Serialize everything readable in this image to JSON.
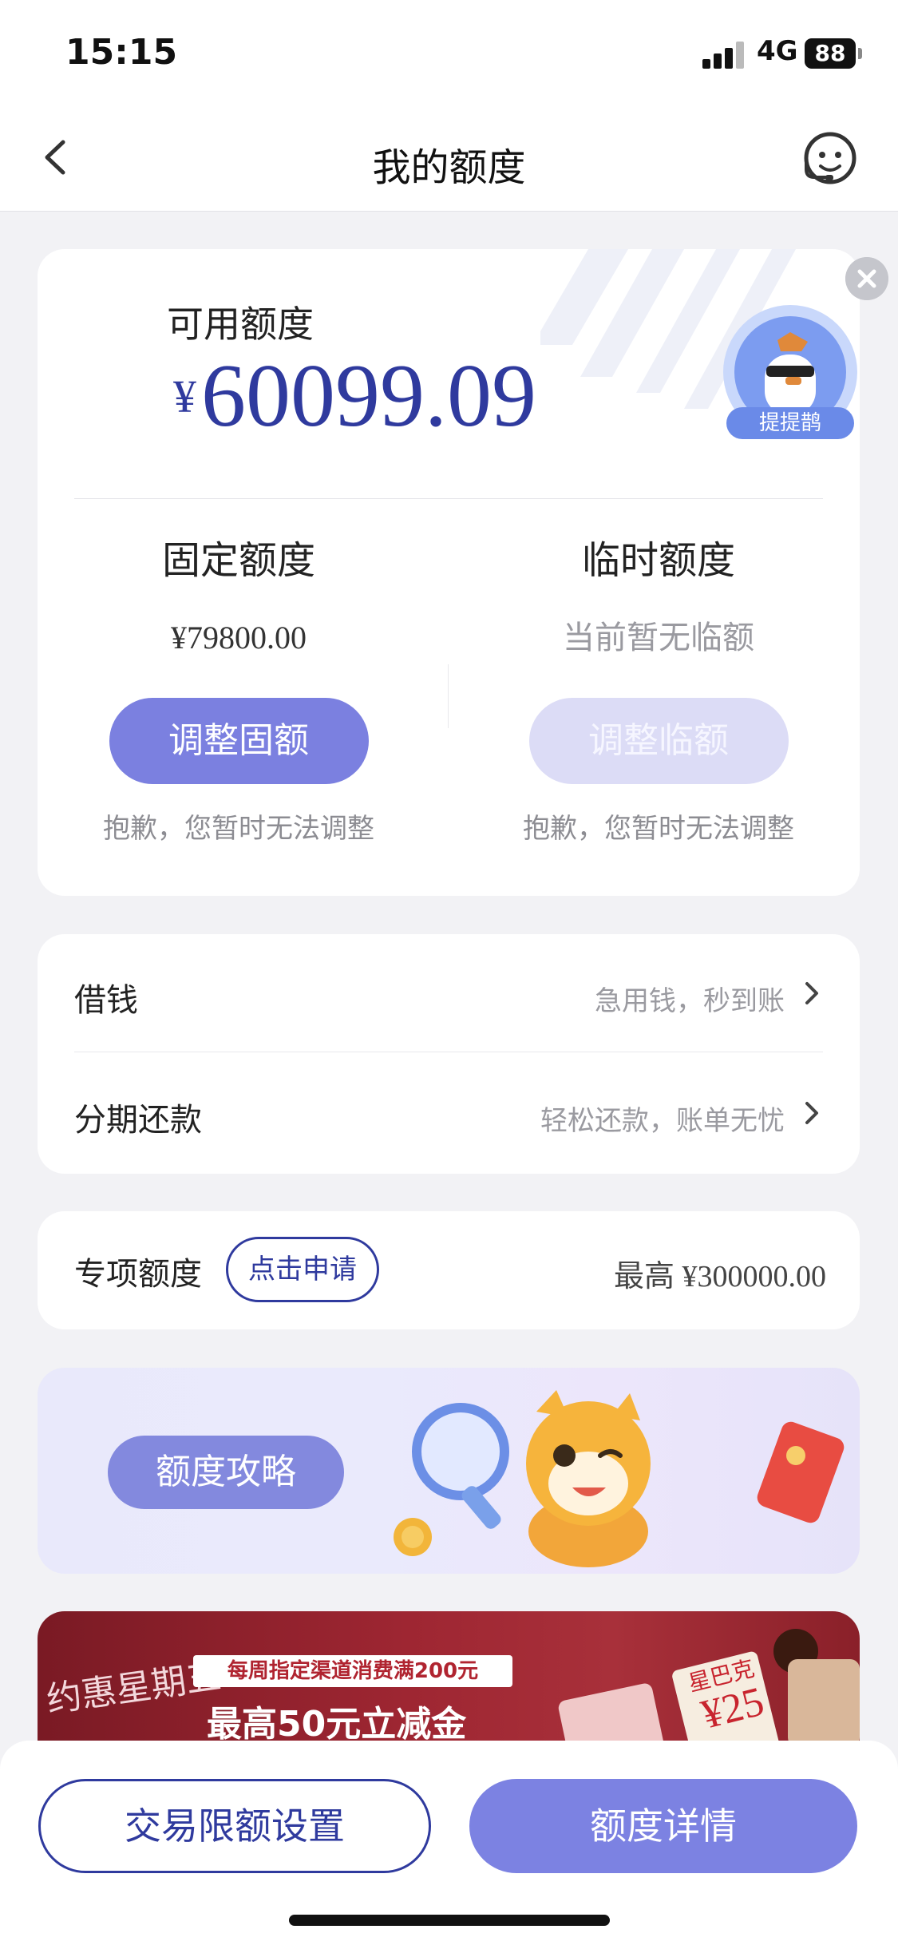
{
  "status_bar": {
    "time": "15:15",
    "network": "4G",
    "battery": "88"
  },
  "nav": {
    "title": "我的额度"
  },
  "quota": {
    "label": "可用额度",
    "currency": "¥",
    "amount": "60099.09",
    "fixed": {
      "title": "固定额度",
      "value": "¥79800.00",
      "button": "调整固额",
      "note": "抱歉，您暂时无法调整"
    },
    "temp": {
      "title": "临时额度",
      "value": "当前暂无临额",
      "button": "调整临额",
      "note": "抱歉，您暂时无法调整"
    },
    "mascot_label": "提提鹊"
  },
  "menu": [
    {
      "label": "借钱",
      "sub": "急用钱，秒到账"
    },
    {
      "label": "分期还款",
      "sub": "轻松还款，账单无忧"
    }
  ],
  "special": {
    "label": "专项额度",
    "apply": "点击申请",
    "max": "最高 ¥300000.00"
  },
  "banner": {
    "button": "额度攻略"
  },
  "promo": {
    "brand": "约惠星期五",
    "tag": "每周指定渠道消费满200元",
    "headline": "最高50元立减金",
    "badge": "¥25",
    "badge_brand": "星巴克"
  },
  "bottom": {
    "left_button": "交易限额设置",
    "right_button": "额度详情"
  },
  "colors": {
    "primary": "#7b80e0",
    "brand_blue": "#2f3a9e",
    "muted": "#9a9aa0"
  }
}
